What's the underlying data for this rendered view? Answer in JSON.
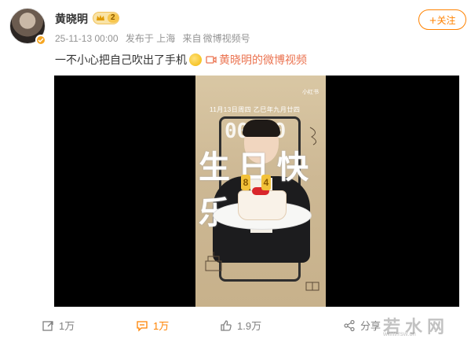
{
  "post": {
    "author": "黄晓明",
    "badge_level": "2",
    "date": "25-11-13 00:00",
    "source_prefix": "发布于 上海",
    "via": "来自",
    "client": "微博视频号",
    "follow_label": "+关注",
    "text": "一不小心把自己吹出了手机",
    "video_link": "黄晓明的微博视频"
  },
  "video": {
    "date_line": "11月13日周四  乙巳年九月廿四",
    "time": "00:00",
    "big_text": "生日快乐",
    "candles": [
      "8",
      "4"
    ],
    "watermark": "小红书"
  },
  "actions": {
    "repost_count": "1万",
    "comment_count": "1万",
    "like_count": "1.9万",
    "share_label": "分享"
  },
  "site_watermark": {
    "main": "若水网",
    "sub": "www.rsw.cn"
  },
  "colors": {
    "accent": "#ff8200",
    "link": "#eb7350",
    "meta_gray": "#939393"
  }
}
